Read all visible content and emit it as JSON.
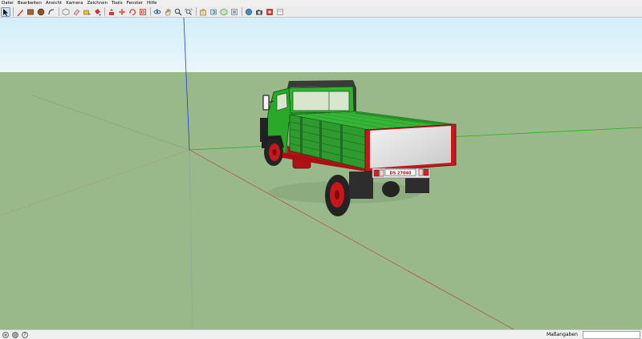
{
  "menu": [
    "Datei",
    "Bearbeiten",
    "Ansicht",
    "Kamera",
    "Zeichnen",
    "Tools",
    "Fenster",
    "Hilfe"
  ],
  "toolbar": {
    "tools": [
      {
        "name": "select-tool",
        "icon": "arrow-cursor",
        "active": true
      },
      {
        "sep": true
      },
      {
        "name": "line-tool",
        "icon": "pencil"
      },
      {
        "name": "rectangle-tool",
        "icon": "rectangle"
      },
      {
        "name": "circle-tool",
        "icon": "circle"
      },
      {
        "name": "arc-tool",
        "icon": "arc"
      },
      {
        "sep": true
      },
      {
        "name": "make-component-tool",
        "icon": "component"
      },
      {
        "name": "eraser-tool",
        "icon": "eraser"
      },
      {
        "name": "tape-measure-tool",
        "icon": "tape-measure"
      },
      {
        "name": "paint-bucket-tool",
        "icon": "paint-bucket"
      },
      {
        "sep": true
      },
      {
        "name": "push-pull-tool",
        "icon": "push-pull"
      },
      {
        "name": "move-tool",
        "icon": "move"
      },
      {
        "name": "rotate-tool",
        "icon": "rotate"
      },
      {
        "name": "offset-tool",
        "icon": "offset"
      },
      {
        "sep": true
      },
      {
        "name": "orbit-tool",
        "icon": "orbit"
      },
      {
        "name": "pan-tool",
        "icon": "hand"
      },
      {
        "name": "zoom-tool",
        "icon": "magnifier"
      },
      {
        "name": "zoom-extents-tool",
        "icon": "zoom-extents"
      },
      {
        "sep": true
      },
      {
        "name": "get-models-button",
        "icon": "warehouse"
      },
      {
        "name": "share-model-button",
        "icon": "share"
      },
      {
        "name": "share-component-button",
        "icon": "share-component"
      },
      {
        "name": "component-library-button",
        "icon": "library"
      },
      {
        "sep": true
      },
      {
        "name": "preview-google-earth-button",
        "icon": "globe"
      },
      {
        "name": "photo-textures-button",
        "icon": "camera"
      },
      {
        "name": "extension-warehouse-button",
        "icon": "extension"
      },
      {
        "name": "layout-button",
        "icon": "layout"
      }
    ]
  },
  "statusbar": {
    "measure_label": "Maßangaben",
    "measure_value": "",
    "icons": [
      "geo-location-icon",
      "credits-icon",
      "help-icon"
    ],
    "help_glyph": "?"
  },
  "scene": {
    "sky_color": "#dff3fb",
    "ground_color": "#99b98b",
    "axis_colors": {
      "red": "#b04a3a",
      "green": "#1fb81f",
      "blue": "#1c3fd6"
    },
    "truck_colors": {
      "cab": "#2aa82a",
      "bed": "#2f9b2f",
      "chassis": "#c8161b",
      "tailgate": "#e4e4e4",
      "tires": "#242424"
    },
    "license_plate": "DS 27040"
  }
}
